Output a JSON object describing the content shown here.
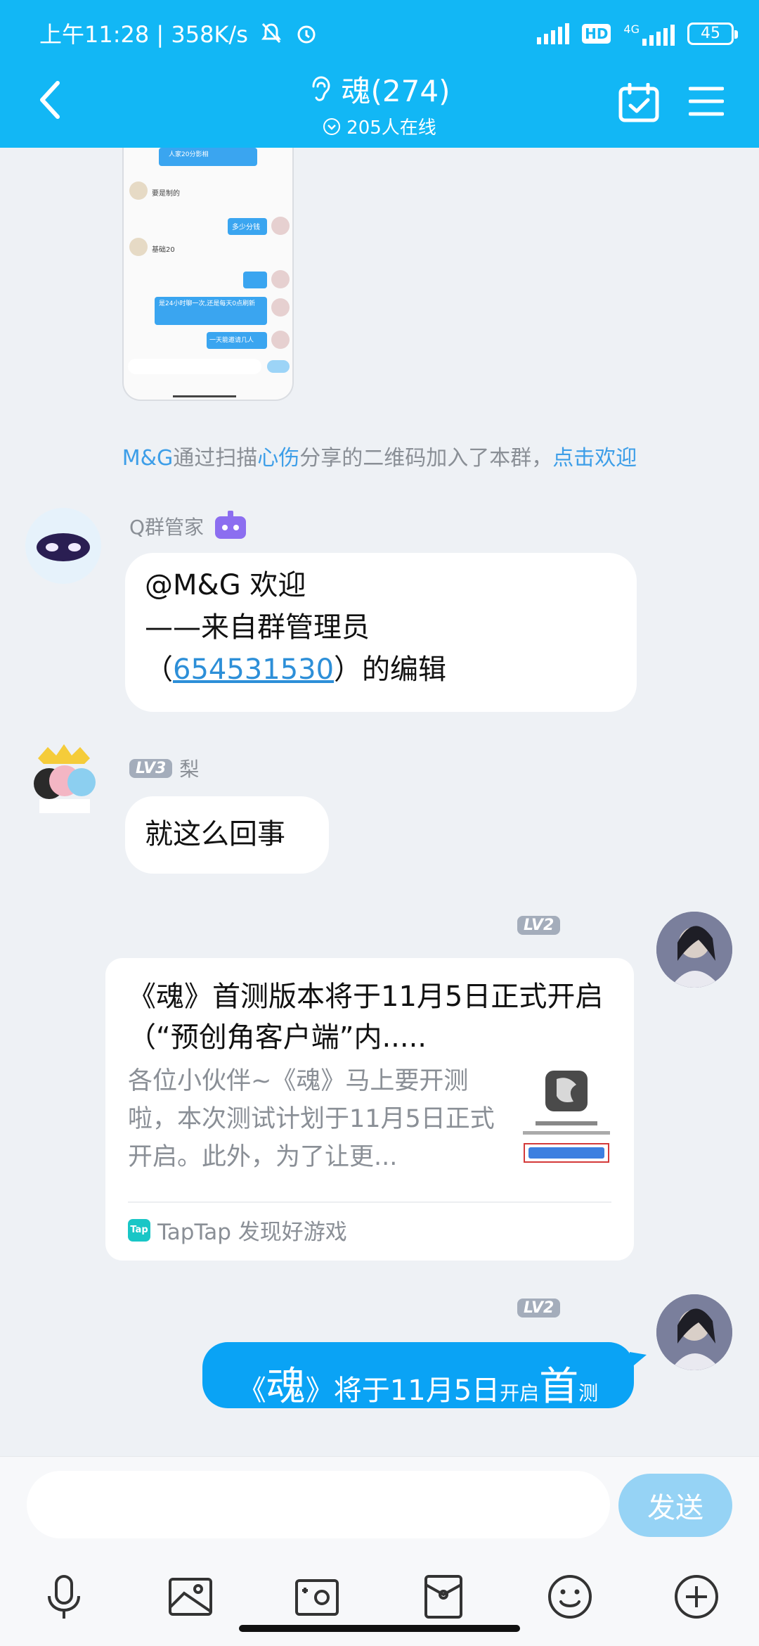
{
  "status_bar": {
    "left_text": "上午11:28 | 358K/s",
    "network": "4G",
    "hd": "HD",
    "battery": "45"
  },
  "header": {
    "title": "魂(274)",
    "online": "205人在线"
  },
  "system_message": {
    "user": "M&G",
    "text1": "通过扫描",
    "sharer": "心伤",
    "text2": "分享的二维码加入了本群，",
    "action": "点击欢迎"
  },
  "messages": [
    {
      "sender": "Q群管家",
      "line1": "@M&G 欢迎",
      "line2": "——来自群管理员",
      "line3_prefix": "（",
      "line3_link": "654531530",
      "line3_suffix": "）的编辑"
    },
    {
      "sender": "梨",
      "level": "LV3",
      "text": "就这么回事"
    },
    {
      "level": "LV2",
      "card_title": "《魂》首测版本将于11月5日正式开启（“预创角客户端”内.....",
      "card_desc": "各位小伙伴~《魂》马上要开测啦，本次测试计划于11月5日正式开启。此外，为了让更...",
      "card_source": "TapTap 发现好游戏",
      "tap_icon_text": "Tap"
    },
    {
      "level": "LV2",
      "parts": [
        "《",
        "魂",
        "》",
        "将于11月5日",
        "开启",
        "首",
        "测"
      ]
    }
  ],
  "thumbnail": {
    "text_top": "人家20分影相",
    "text_a": "要是制的",
    "text_b": "多少分钱",
    "text_c": "基础20",
    "text_d": "是24小时聊一次,还是每天0点刷新",
    "text_e": "一天能邀请几人"
  },
  "input": {
    "send_label": "发送"
  },
  "icons": [
    "back-icon",
    "ear-icon",
    "calendar-check-icon",
    "menu-icon",
    "mic-icon",
    "image-icon",
    "camera-icon",
    "red-packet-icon",
    "emoji-icon",
    "plus-icon",
    "robot-icon"
  ]
}
